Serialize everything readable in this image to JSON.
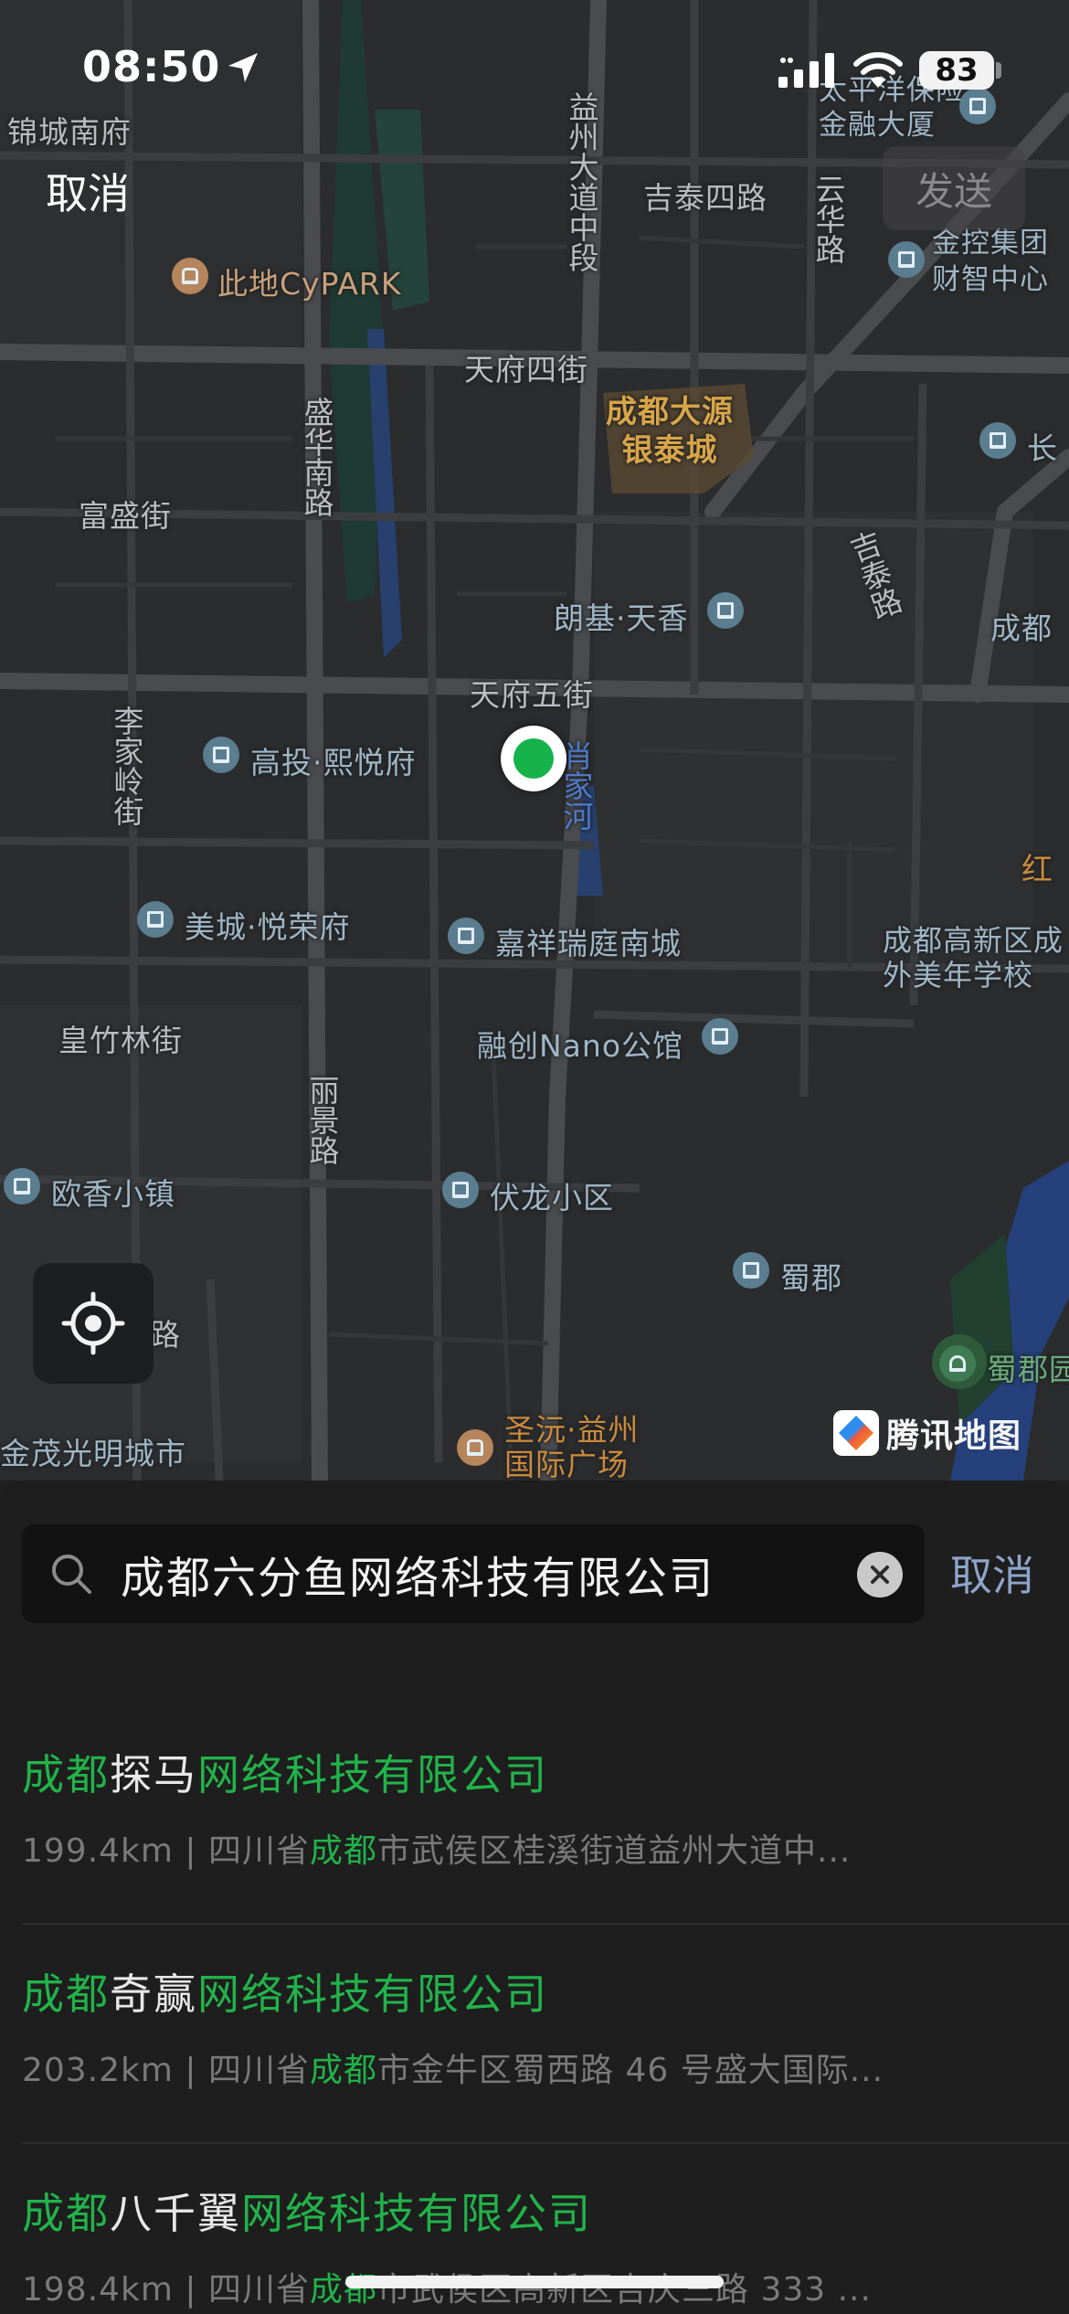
{
  "status_bar": {
    "time": "08:50",
    "battery": "83"
  },
  "map": {
    "cancel_label": "取消",
    "send_label": "发送",
    "logo_text": "腾讯地图",
    "labels": {
      "jincheng_nanfu": "锦城南府",
      "cidi_cypark": "此地CyPARK",
      "yizhou_dadao": "益州大道中段",
      "jitai_silu": "吉泰四路",
      "yunhua_lu": "云华路",
      "taipingyang": "太平洋保险金融大厦",
      "jinkong": "金控集团财智中心",
      "tianfu_sijie": "天府四街",
      "shenghua_nanlu": "盛华南路",
      "yintai_cheng": "成都大源银泰城",
      "fusheng_jie": "富盛街",
      "jitai_lu": "吉泰路",
      "langji_tianxiang": "朗基·天香",
      "chengdu_shi": "成都",
      "tianfu_wujie": "天府五街",
      "lijialing_jie": "李家岭街",
      "gaotou_xiyuefu": "高投·熙悦府",
      "xiaojia_he": "肖家河",
      "meicheng_yuerongfu": "美城·悦荣府",
      "jiaxiang_ruiting": "嘉祥瑞庭南城",
      "chengdu_gaoxin": "成都高新区成外美年学校",
      "hong": "红",
      "huangzhulin_jie": "皇竹林街",
      "rongchuang_nano": "融创Nano公馆",
      "lijing_lu": "丽景路",
      "ouxiang_xiaozhen": "欧香小镇",
      "fulong_xiaoqu": "伏龙小区",
      "shujun": "蜀郡",
      "shujun_park": "蜀郡园",
      "jinmao_guangming": "金茂光明城市",
      "shengyuan_yizhou": "圣沅·益州国际广场",
      "lu": "路",
      "chang": "长"
    }
  },
  "search": {
    "query": "成都六分鱼网络科技有限公司",
    "cancel_label": "取消"
  },
  "results": [
    {
      "name_hl1": "成都",
      "name_mid": "探马",
      "name_hl2": "网络科技有限公司",
      "addr_pre": "199.4km | 四川省",
      "addr_hl": "成都",
      "addr_post": "市武侯区桂溪街道益州大道中..."
    },
    {
      "name_hl1": "成都",
      "name_mid": "奇赢",
      "name_hl2": "网络科技有限公司",
      "addr_pre": "203.2km | 四川省",
      "addr_hl": "成都",
      "addr_post": "市金牛区蜀西路 46 号盛大国际..."
    },
    {
      "name_hl1": "成都",
      "name_mid": "八千翼",
      "name_hl2": "网络科技有限公司",
      "addr_pre": "198.4km | 四川省",
      "addr_hl": "成都",
      "addr_post": "市武侯区高新区吉庆三路 333 ..."
    }
  ],
  "colors": {
    "highlight": "#22b34a",
    "location_dot": "#15b34a",
    "cancel_link": "#8ea5c9"
  },
  "icons": [
    "location-arrow-icon",
    "signal-icon",
    "wifi-icon",
    "battery-icon",
    "locate-icon",
    "search-icon",
    "clear-icon",
    "building-icon",
    "shop-icon",
    "park-icon"
  ]
}
